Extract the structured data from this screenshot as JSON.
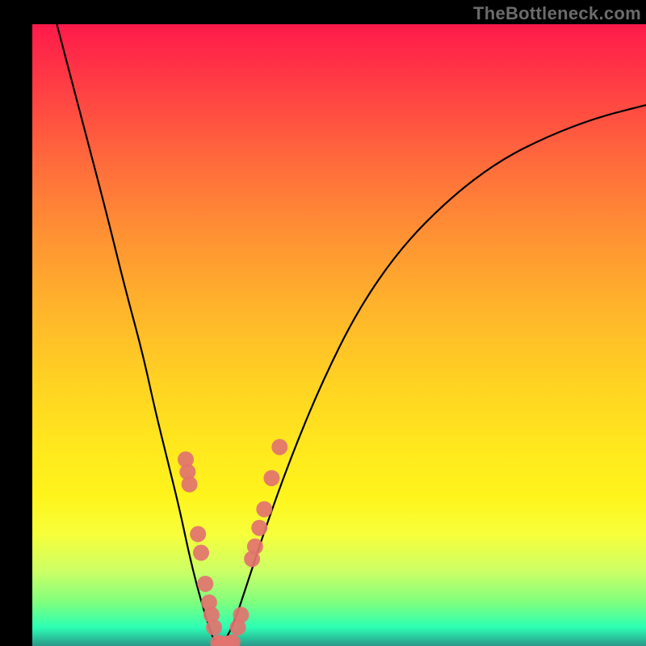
{
  "watermark": "TheBottleneck.com",
  "chart_data": {
    "type": "line",
    "title": "",
    "xlabel": "",
    "ylabel": "",
    "xlim": [
      0,
      100
    ],
    "ylim": [
      0,
      100
    ],
    "series": [
      {
        "name": "bottleneck-curve",
        "x": [
          4,
          8,
          12,
          15,
          18,
          20,
          22,
          24,
          25.5,
          27,
          28.5,
          29.5,
          30.5,
          31.5,
          33,
          35,
          38,
          42,
          47,
          53,
          60,
          68,
          76,
          84,
          92,
          100
        ],
        "y": [
          100,
          85,
          70,
          58,
          47,
          38,
          30,
          22,
          15,
          9,
          4,
          1,
          0,
          1,
          4,
          10,
          19,
          30,
          42,
          54,
          64,
          72,
          78,
          82,
          85,
          87
        ]
      }
    ],
    "markers": {
      "name": "data-points",
      "color": "#e2736f",
      "points": [
        {
          "x": 25.0,
          "y": 30
        },
        {
          "x": 25.3,
          "y": 28
        },
        {
          "x": 25.6,
          "y": 26
        },
        {
          "x": 27.0,
          "y": 18
        },
        {
          "x": 27.5,
          "y": 15
        },
        {
          "x": 28.2,
          "y": 10
        },
        {
          "x": 28.8,
          "y": 7
        },
        {
          "x": 29.2,
          "y": 5
        },
        {
          "x": 29.6,
          "y": 3
        },
        {
          "x": 30.3,
          "y": 0.5
        },
        {
          "x": 30.8,
          "y": 0.3
        },
        {
          "x": 31.4,
          "y": 0.3
        },
        {
          "x": 32.0,
          "y": 0.4
        },
        {
          "x": 32.6,
          "y": 0.6
        },
        {
          "x": 33.5,
          "y": 3
        },
        {
          "x": 34.0,
          "y": 5
        },
        {
          "x": 35.8,
          "y": 14
        },
        {
          "x": 36.3,
          "y": 16
        },
        {
          "x": 37.0,
          "y": 19
        },
        {
          "x": 37.8,
          "y": 22
        },
        {
          "x": 39.0,
          "y": 27
        },
        {
          "x": 40.3,
          "y": 32
        }
      ]
    },
    "gradient_stops": [
      {
        "pos": 0,
        "color": "#ff1a4a"
      },
      {
        "pos": 10,
        "color": "#ff3e44"
      },
      {
        "pos": 22,
        "color": "#ff6a3c"
      },
      {
        "pos": 34,
        "color": "#ff9233"
      },
      {
        "pos": 46,
        "color": "#ffb52b"
      },
      {
        "pos": 58,
        "color": "#ffd322"
      },
      {
        "pos": 68,
        "color": "#ffe81e"
      },
      {
        "pos": 76,
        "color": "#fff41c"
      },
      {
        "pos": 82,
        "color": "#f7ff3a"
      },
      {
        "pos": 88,
        "color": "#ccff66"
      },
      {
        "pos": 93,
        "color": "#7eff7e"
      },
      {
        "pos": 97,
        "color": "#2cffb4"
      },
      {
        "pos": 100,
        "color": "#29998a"
      }
    ]
  }
}
